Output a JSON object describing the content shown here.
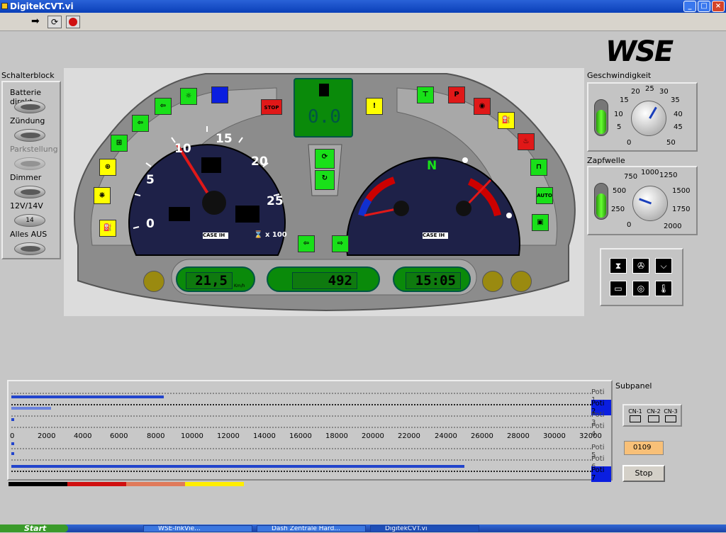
{
  "window": {
    "title": "DigitekCVT.vi"
  },
  "header": {
    "logo": "WSE"
  },
  "switches": {
    "title": "Schalterblock",
    "items": [
      {
        "label": "Batterie direkt",
        "enabled": true
      },
      {
        "label": "Zündung",
        "enabled": true
      },
      {
        "label": "Parkstellung",
        "enabled": false
      },
      {
        "label": "Dimmer",
        "enabled": true
      },
      {
        "label": "12V/14V",
        "enabled": true,
        "value": "14"
      },
      {
        "label": "Alles AUS",
        "enabled": true
      }
    ]
  },
  "speedometer": {
    "ticks": [
      "0",
      "5",
      "10",
      "15",
      "20",
      "25"
    ],
    "unit": "x 100",
    "brand": "CASE IH"
  },
  "center": {
    "gear": "0.0",
    "gear_right": "N",
    "brand": "CASE IH"
  },
  "displays": {
    "speed": "21,5",
    "speed_unit": "Km/h",
    "hours": "492",
    "time": "15:05"
  },
  "geschwindigkeit": {
    "label": "Geschwindigkeit",
    "ticks": [
      "0",
      "5",
      "10",
      "15",
      "20",
      "25",
      "30",
      "35",
      "40",
      "45",
      "50"
    ],
    "value": 25
  },
  "zapfwelle": {
    "label": "Zapfwelle",
    "ticks": [
      "0",
      "250",
      "500",
      "750",
      "1000",
      "1250",
      "1500",
      "1750",
      "2000"
    ],
    "value": 400
  },
  "sliders": {
    "axis": [
      "0",
      "2000",
      "4000",
      "6000",
      "8000",
      "10000",
      "12000",
      "14000",
      "16000",
      "18000",
      "20000",
      "22000",
      "24000",
      "26000",
      "28000",
      "30000",
      "32000"
    ],
    "channels": [
      {
        "name": "Poti 1",
        "value": 200
      },
      {
        "name": "Poti 2",
        "value": 8400
      },
      {
        "name": "Poti 3",
        "value": 2200
      },
      {
        "name": "Poti 4",
        "value": 150
      },
      {
        "name": "Poti 5",
        "value": 150
      },
      {
        "name": "Poti 6",
        "value": 25000
      },
      {
        "name": "Poti 7",
        "value": 150
      }
    ]
  },
  "subpanel": {
    "label": "Subpanel",
    "cn": [
      "CN-1",
      "CN-2",
      "CN-3"
    ],
    "counter": "0109",
    "stop": "Stop"
  },
  "colors": {
    "lcd": "#0a8a0a",
    "gauge_face": "#1e2148",
    "needle": "#e01818",
    "bar": [
      "#000000",
      "#d01010",
      "#e07a5a",
      "#ffee00"
    ]
  },
  "taskbar": {
    "start": "Start",
    "tasks": [
      "WSE-InkVie...",
      "Dash Zentrale Hard...",
      "DigitekCVT.vi"
    ]
  }
}
